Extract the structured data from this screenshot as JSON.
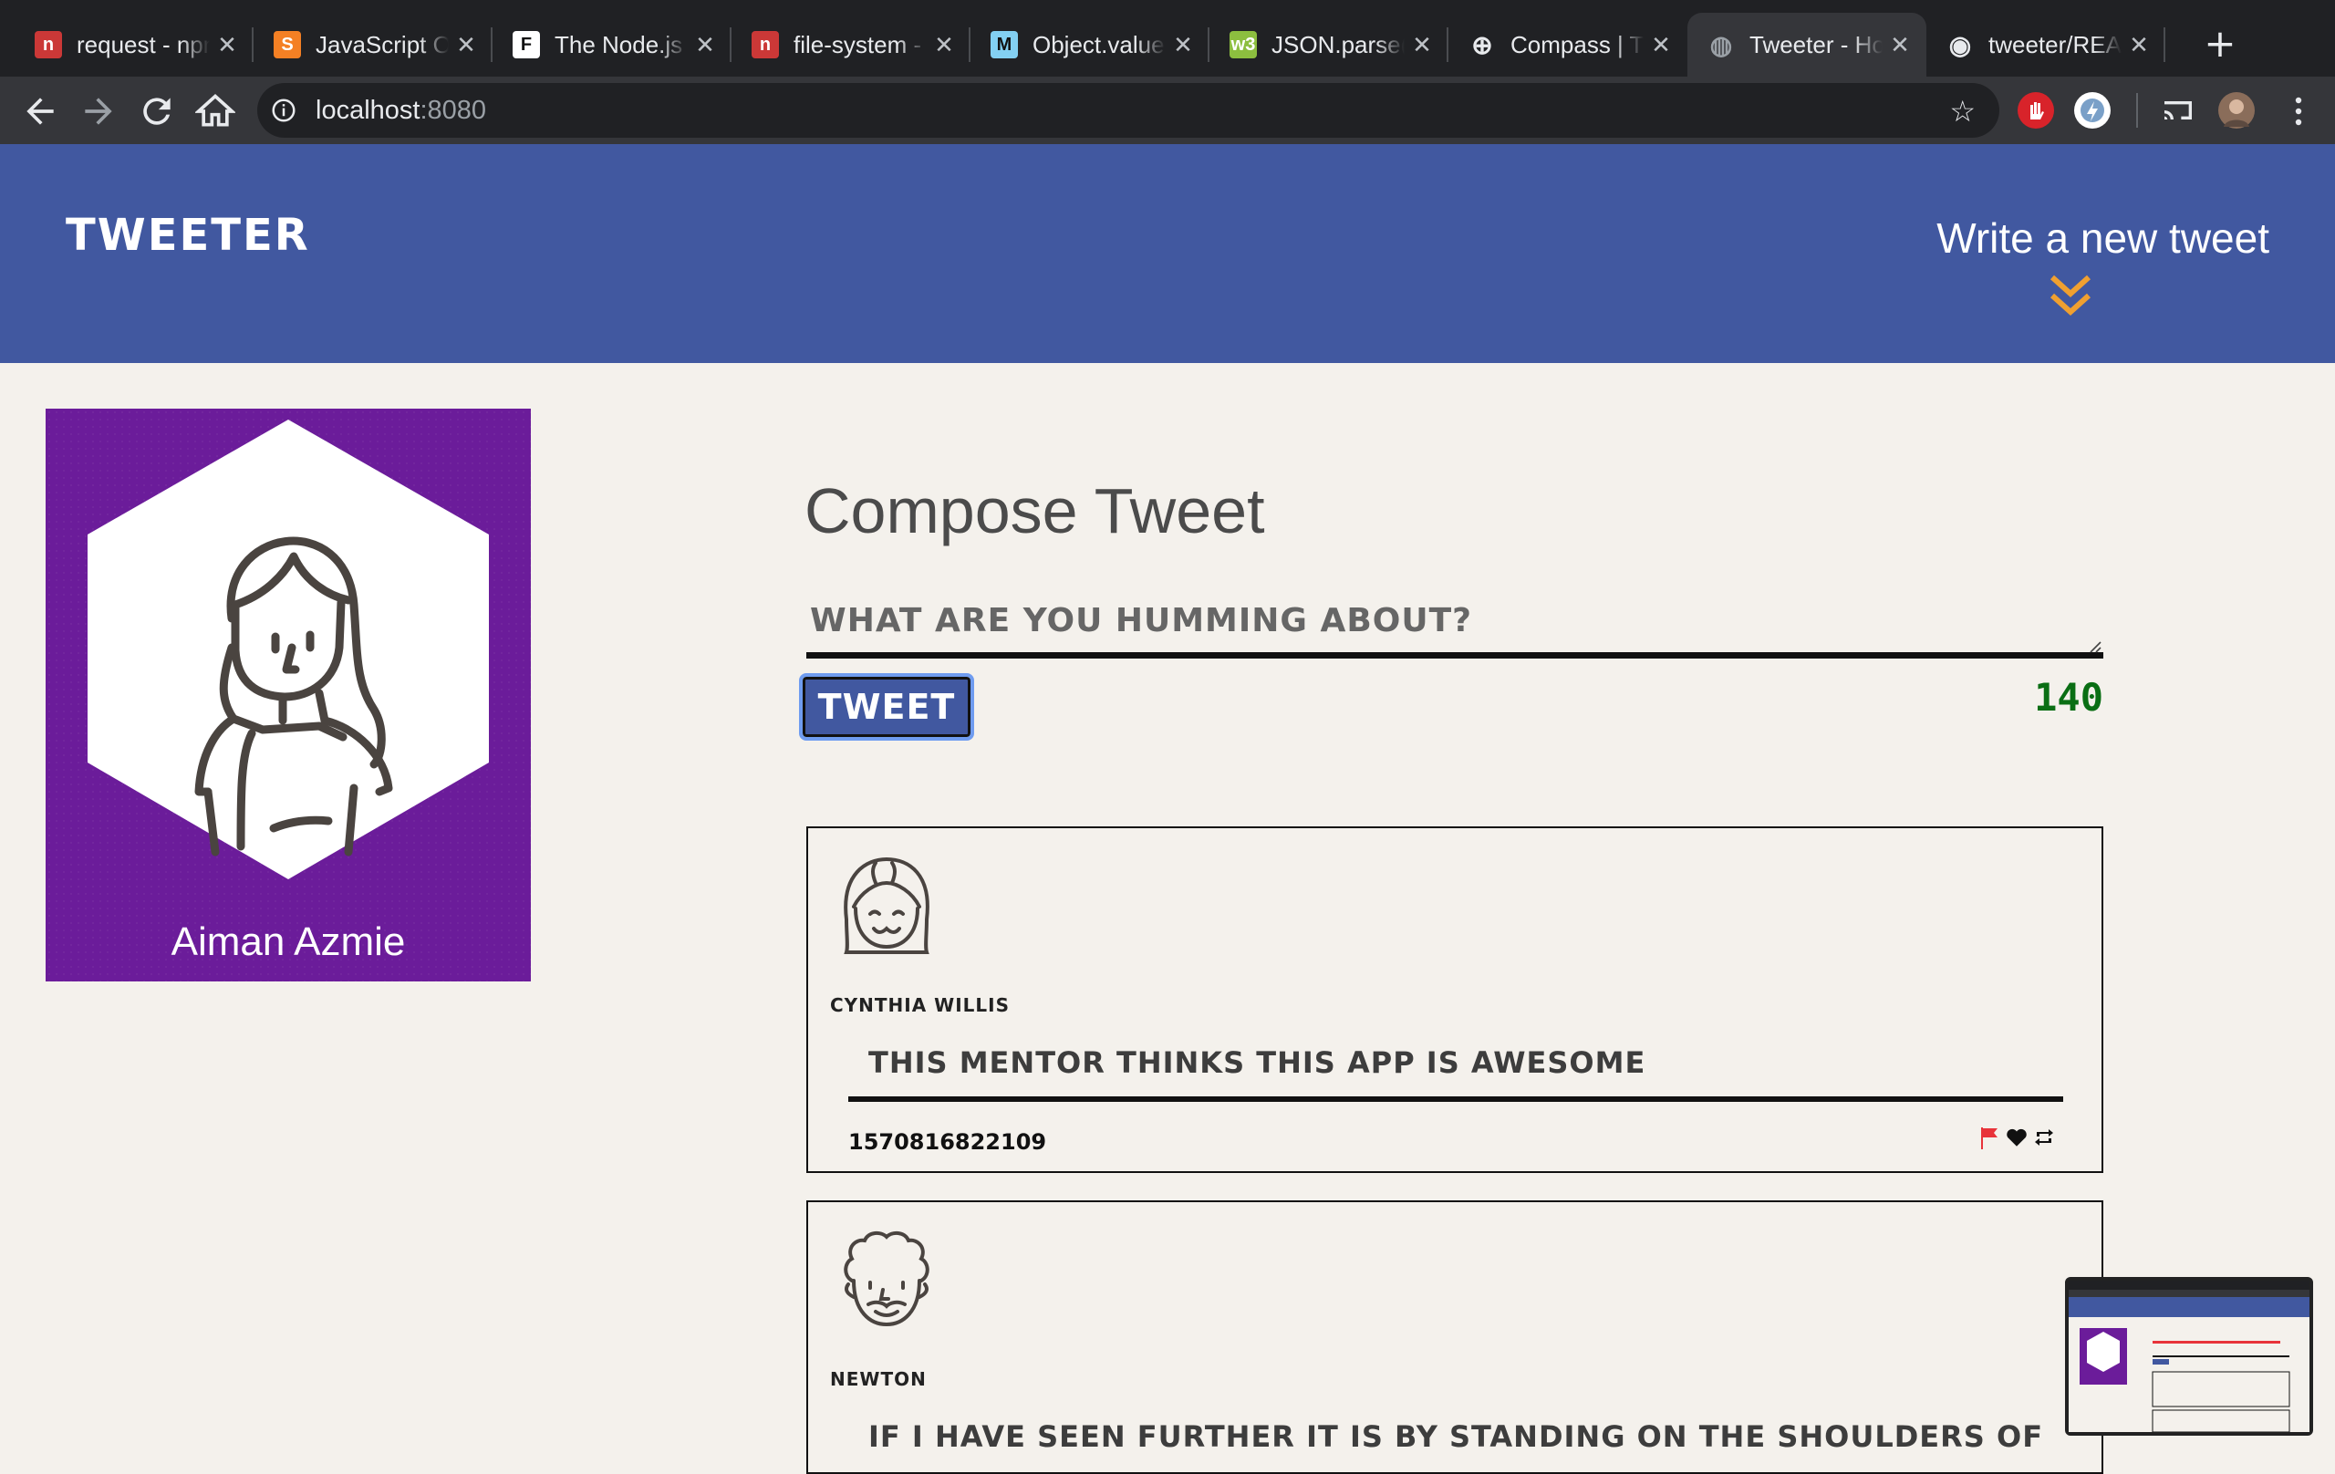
{
  "browser": {
    "tabs": [
      {
        "title": "request - npm",
        "icon": "npm-icon",
        "color": "#cb3837",
        "glyph": "n",
        "active": false
      },
      {
        "title": "JavaScript ODM",
        "icon": "stackoverflow-icon",
        "color": "#f48024",
        "glyph": "S",
        "active": false
      },
      {
        "title": "The Node.js fs",
        "icon": "f-icon",
        "color": "#ffffff",
        "glyph": "F",
        "active": false
      },
      {
        "title": "file-system - npm",
        "icon": "npm-icon",
        "color": "#cb3837",
        "glyph": "n",
        "active": false
      },
      {
        "title": "Object.values()",
        "icon": "mdn-icon",
        "color": "#83d0f2",
        "glyph": "M",
        "active": false
      },
      {
        "title": "JSON.parse()",
        "icon": "w3-icon",
        "color": "#8cbe3f",
        "glyph": "w3",
        "active": false
      },
      {
        "title": "Compass | T",
        "icon": "compass-icon",
        "color": "#e8eaed",
        "glyph": "⊕",
        "active": false
      },
      {
        "title": "Tweeter - Home",
        "icon": "globe-icon",
        "color": "#9aa0a6",
        "glyph": "◍",
        "active": true
      },
      {
        "title": "tweeter/README",
        "icon": "github-icon",
        "color": "#e8eaed",
        "glyph": "◉",
        "active": false
      }
    ],
    "new_tab_label": "+",
    "address_host": "localhost",
    "address_port": ":8080"
  },
  "header": {
    "brand": "TWEETER",
    "write_new": "Write a new tweet"
  },
  "profile": {
    "name": "Aiman Azmie"
  },
  "compose": {
    "title": "Compose Tweet",
    "placeholder": "WHAT ARE YOU HUMMING ABOUT?",
    "button": "TWEET",
    "counter": "140"
  },
  "tweets": [
    {
      "handle": "CYNTHIA WILLIS",
      "text": "THIS MENTOR THINKS THIS APP IS AWESOME",
      "timestamp": "1570816822109"
    },
    {
      "handle": "NEWTON",
      "text": "IF I HAVE SEEN FURTHER IT IS BY STANDING ON THE SHOULDERS OF",
      "timestamp": ""
    }
  ],
  "colors": {
    "header_bg": "#4158a0",
    "profile_bg": "#6b1c9a",
    "counter": "#0a6e14",
    "chevron": "#f0a030",
    "flag": "#e8333a"
  }
}
